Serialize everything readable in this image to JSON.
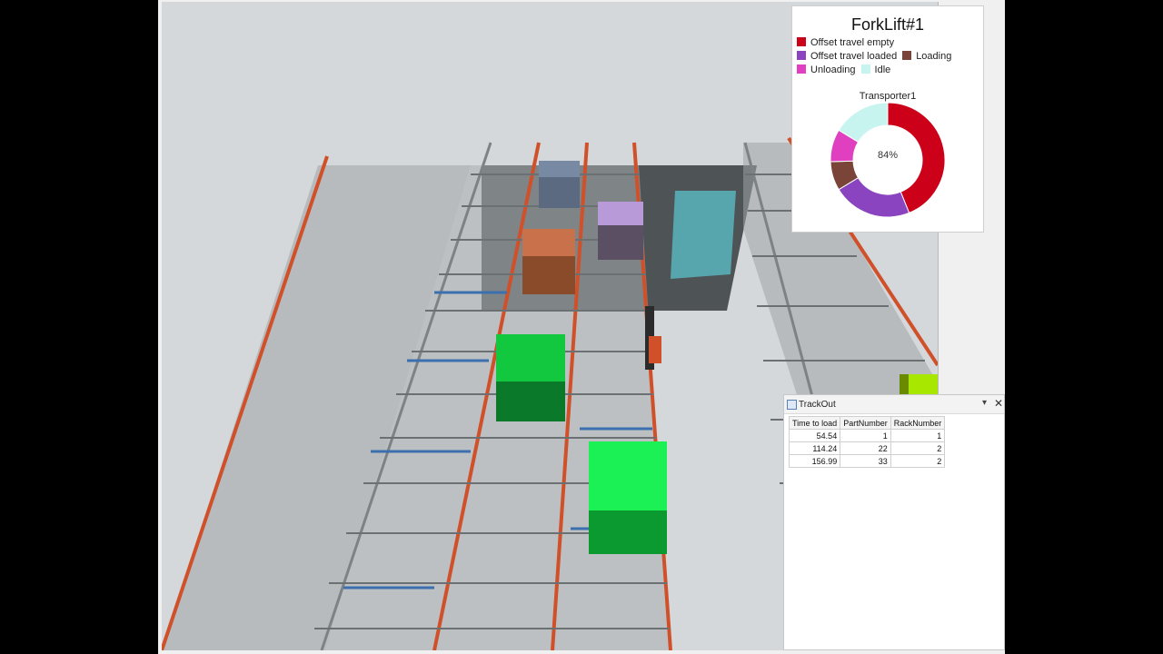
{
  "chart": {
    "title": "ForkLift#1",
    "legend_rows": [
      [
        {
          "label": "Offset travel empty",
          "color": "#cc0018"
        }
      ],
      [
        {
          "label": "Offset travel loaded",
          "color": "#8b44c0"
        },
        {
          "label": "Loading",
          "color": "#7a4438"
        }
      ],
      [
        {
          "label": "Unloading",
          "color": "#e040c0"
        },
        {
          "label": "Idle",
          "color": "#c8f4f0"
        }
      ]
    ],
    "series_label": "Transporter1",
    "center_text": "84%"
  },
  "chart_data": {
    "type": "pie",
    "title": "ForkLift#1",
    "categories": [
      "Offset travel empty",
      "Offset travel loaded",
      "Loading",
      "Unloading",
      "Idle"
    ],
    "values": [
      43,
      22,
      8,
      9,
      16
    ],
    "colors": [
      "#cc0018",
      "#8b44c0",
      "#7a4438",
      "#e040c0",
      "#c8f4f0"
    ]
  },
  "table_window": {
    "title": "TrackOut",
    "pin_icon": "▾",
    "close_icon": "✕",
    "columns": [
      "Time to load",
      "PartNumber",
      "RackNumber"
    ],
    "rows": [
      [
        "54.54",
        "1",
        "1"
      ],
      [
        "114.24",
        "22",
        "2"
      ],
      [
        "156.99",
        "33",
        "2"
      ]
    ]
  }
}
